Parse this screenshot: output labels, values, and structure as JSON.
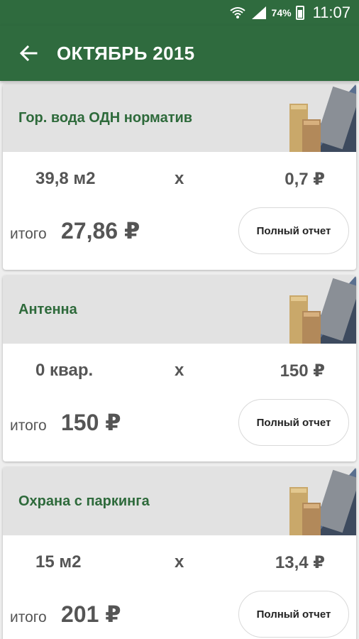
{
  "status": {
    "battery": "74%",
    "time": "11:07"
  },
  "appbar": {
    "title": "ОКТЯБРЬ 2015"
  },
  "cards": [
    {
      "name": "Гор. вода ОДН норматив",
      "qty": "39,8 м2",
      "mult": "x",
      "price": "0,7 ₽",
      "total_label": "итого",
      "total": "27,86 ₽",
      "button": "Полный отчет"
    },
    {
      "name": "Антенна",
      "qty": "0 квар.",
      "mult": "x",
      "price": "150 ₽",
      "total_label": "итого",
      "total": "150 ₽",
      "button": "Полный отчет"
    },
    {
      "name": "Охрана с паркинга",
      "qty": "15 м2",
      "mult": "x",
      "price": "13,4 ₽",
      "total_label": "итого",
      "total": "201 ₽",
      "button": "Полный отчет"
    }
  ]
}
